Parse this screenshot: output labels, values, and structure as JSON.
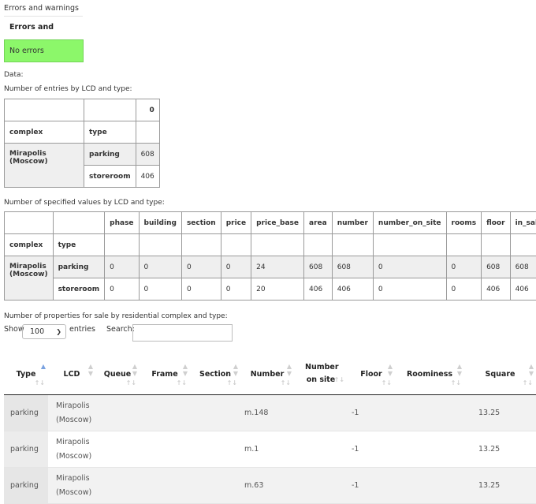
{
  "title": "Errors and warnings",
  "errors_header": "Errors and warnings",
  "errors_status": "No errors",
  "data_label": "Data:",
  "table1": {
    "caption": "Number of entries by LCD and type:",
    "col_header": "0",
    "index_names": [
      "complex",
      "type"
    ],
    "complex": "Mirapolis (Moscow)",
    "rows": [
      {
        "type": "parking",
        "value": "608"
      },
      {
        "type": "storeroom",
        "value": "406"
      }
    ]
  },
  "table2": {
    "caption": "Number of specified values by LCD and type:",
    "columns": [
      "phase",
      "building",
      "section",
      "price",
      "price_base",
      "area",
      "number",
      "number_on_site",
      "rooms",
      "floor",
      "in_sale"
    ],
    "index_names": [
      "complex",
      "type"
    ],
    "complex": "Mirapolis (Moscow)",
    "rows": [
      {
        "type": "parking",
        "values": [
          "0",
          "0",
          "0",
          "0",
          "24",
          "608",
          "608",
          "0",
          "0",
          "608",
          "608"
        ]
      },
      {
        "type": "storeroom",
        "values": [
          "0",
          "0",
          "0",
          "0",
          "20",
          "406",
          "406",
          "0",
          "0",
          "406",
          "406"
        ]
      }
    ]
  },
  "table3": {
    "caption": "Number of properties for sale by residential complex and type:",
    "show_label": "Show",
    "entries_value": "100",
    "entries_label": "entries",
    "search_label": "Search:",
    "search_value": "",
    "headers": [
      "Type",
      "LCD",
      "Queue",
      "Frame",
      "Section",
      "Number",
      "Number on site",
      "Floor",
      "Roominess",
      "Square"
    ],
    "rows": [
      {
        "type": "parking",
        "lcd": "Mirapolis (Moscow)",
        "queue": "",
        "frame": "",
        "section": "",
        "number": "m.148",
        "number_on_site": "",
        "floor": "-1",
        "roominess": "",
        "square": "13.25"
      },
      {
        "type": "parking",
        "lcd": "Mirapolis (Moscow)",
        "queue": "",
        "frame": "",
        "section": "",
        "number": "m.1",
        "number_on_site": "",
        "floor": "-1",
        "roominess": "",
        "square": "13.25"
      },
      {
        "type": "parking",
        "lcd": "Mirapolis (Moscow)",
        "queue": "",
        "frame": "",
        "section": "",
        "number": "m.63",
        "number_on_site": "",
        "floor": "-1",
        "roominess": "",
        "square": "13.25"
      }
    ]
  }
}
